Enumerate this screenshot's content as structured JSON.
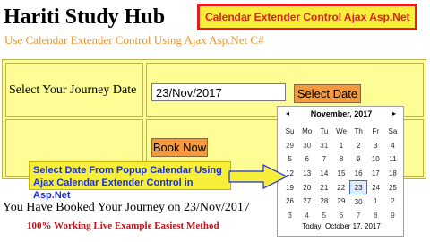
{
  "header": {
    "site_title": "Hariti Study Hub",
    "banner": "Calendar Extender Control Ajax Asp.Net",
    "subtitle": "Use Calendar Extender Control Using Ajax Asp.Net C#"
  },
  "form": {
    "journey_label": "Select Your Journey Date",
    "date_value": "23/Nov/2017",
    "select_date_button": "Select Date",
    "book_now_button": "Book Now"
  },
  "calendar": {
    "prev": "◂",
    "next": "▸",
    "month_title": "November, 2017",
    "weekdays": [
      "Su",
      "Mo",
      "Tu",
      "We",
      "Th",
      "Fr",
      "Sa"
    ],
    "weeks": [
      [
        "29",
        "30",
        "31",
        "1",
        "2",
        "3",
        "4"
      ],
      [
        "5",
        "6",
        "7",
        "8",
        "9",
        "10",
        "11"
      ],
      [
        "12",
        "13",
        "14",
        "15",
        "16",
        "17",
        "18"
      ],
      [
        "19",
        "20",
        "21",
        "22",
        "23",
        "24",
        "25"
      ],
      [
        "26",
        "27",
        "28",
        "29",
        "30",
        "1",
        "2"
      ],
      [
        "3",
        "4",
        "5",
        "6",
        "7",
        "8",
        "9"
      ]
    ],
    "selected": "23",
    "today_label": "Today: October 17, 2017"
  },
  "callout": {
    "text": "Select Date From Popup Calendar Using Ajax Calendar Extender Control in Asp.Net"
  },
  "result": {
    "confirmation": "You Have Booked Your Journey on 23/Nov/2017"
  },
  "footer": {
    "tagline": "100% Working Live Example Easiest Method"
  },
  "colors": {
    "banner_bg": "#f5ef3a",
    "banner_border": "#e01e1e",
    "table_bg": "#fdfc95",
    "button_bg": "#f49a3c",
    "subtitle": "#f0942a",
    "callout_text": "#1c2fd6",
    "tagline": "#c0141a"
  }
}
